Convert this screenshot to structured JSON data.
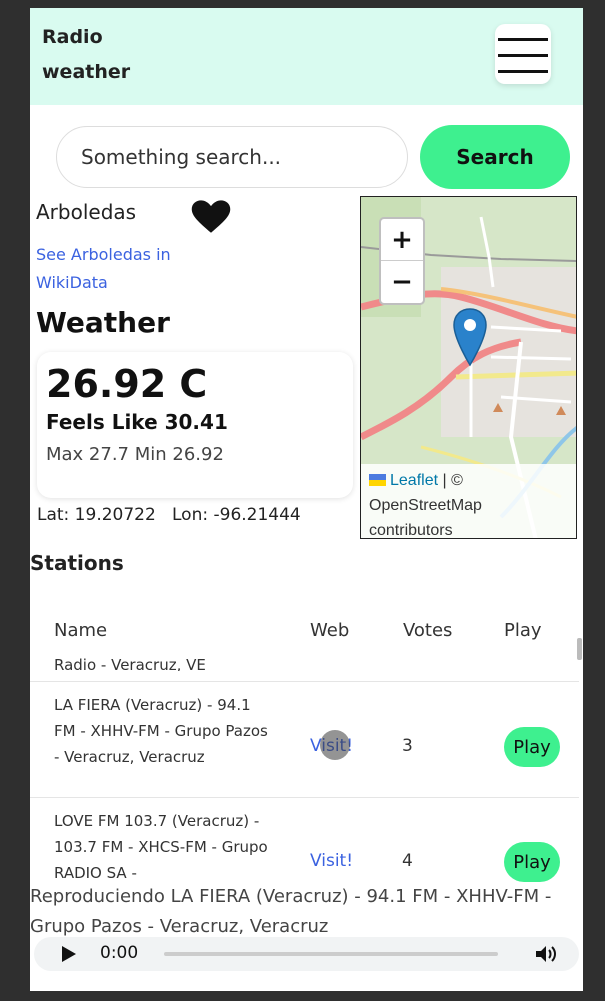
{
  "header": {
    "brand": "Radio weather"
  },
  "search": {
    "placeholder": "Something search...",
    "button_label": "Search"
  },
  "place": {
    "name": "Arboledas",
    "wiki_link": "See Arboledas in WikiData"
  },
  "weather": {
    "title": "Weather",
    "temperature": "26.92 C",
    "feels_like": "Feels Like 30.41",
    "max_min": "Max 27.7 Min 26.92",
    "coords": "Lat: 19.20722   Lon: -96.21444"
  },
  "map": {
    "zoom_in": "+",
    "zoom_out": "−",
    "attribution_leaflet": "Leaflet",
    "attribution_sep": " | © ",
    "attribution_osm": "OpenStreetMap contributors"
  },
  "stations": {
    "title": "Stations",
    "columns": {
      "name": "Name",
      "web": "Web",
      "votes": "Votes",
      "play": "Play"
    },
    "rows": [
      {
        "name": "Radio - Veracruz, VE",
        "web": "",
        "votes": "",
        "play": ""
      },
      {
        "name": "LA FIERA (Veracruz) - 94.1 FM - XHHV-FM - Grupo Pazos - Veracruz, Veracruz",
        "web": "Visit!",
        "votes": "3",
        "play": "Play"
      },
      {
        "name": "LOVE FM 103.7 (Veracruz) - 103.7 FM - XHCS-FM - Grupo RADIO SA -",
        "web": "Visit!",
        "votes": "4",
        "play": "Play"
      }
    ]
  },
  "player": {
    "now_playing": "Reproduciendo LA FIERA (Veracruz) - 94.1 FM - XHHV-FM - Grupo Pazos - Veracruz, Veracruz",
    "time": "0:00"
  },
  "colors": {
    "accent": "#3ef08f",
    "header_bg": "#d9fbf0",
    "link": "#3b62e0"
  }
}
